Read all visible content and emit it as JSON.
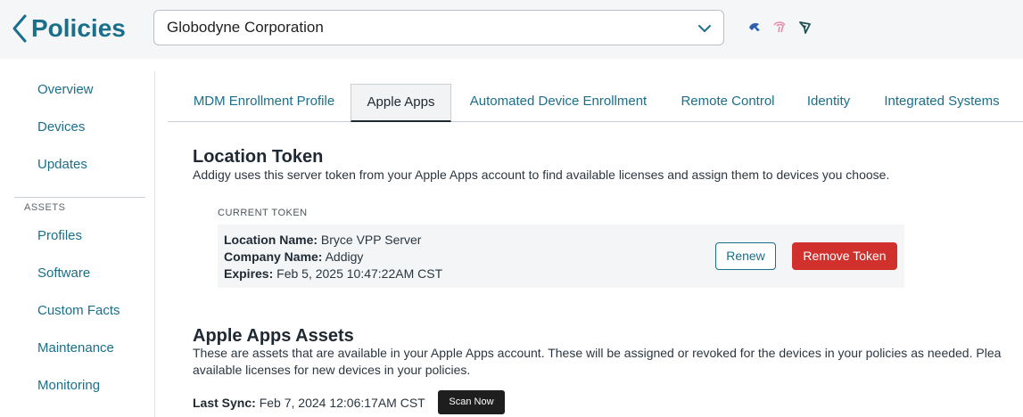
{
  "header": {
    "back_title": "Policies",
    "org_selected": "Globodyne Corporation",
    "icons": [
      "cursor-icon",
      "fingerprint-icon",
      "location-icon"
    ]
  },
  "sidebar": {
    "items_top": [
      "Overview",
      "Devices",
      "Updates"
    ],
    "section_label": "ASSETS",
    "items_assets": [
      "Profiles",
      "Software",
      "Custom Facts",
      "Maintenance",
      "Monitoring"
    ]
  },
  "tabs": [
    "MDM Enrollment Profile",
    "Apple Apps",
    "Automated Device Enrollment",
    "Remote Control",
    "Identity",
    "Integrated Systems"
  ],
  "active_tab": "Apple Apps",
  "location_token": {
    "title": "Location Token",
    "description": "Addigy uses this server token from your Apple Apps account to find available licenses and assign them to devices you choose.",
    "current_label": "CURRENT TOKEN",
    "location_name_label": "Location Name:",
    "location_name": "Bryce VPP Server",
    "company_name_label": "Company Name:",
    "company_name": "Addigy",
    "expires_label": "Expires:",
    "expires": "Feb 5, 2025 10:47:22AM CST",
    "renew_label": "Renew",
    "remove_label": "Remove Token"
  },
  "assets": {
    "title": "Apple Apps Assets",
    "description_line1": "These are assets that are available in your Apple Apps account. These will be assigned or revoked for the devices in your policies as needed. Plea",
    "description_line2": "available licenses for new devices in your policies.",
    "last_sync_label": "Last Sync:",
    "last_sync": "Feb 7, 2024 12:06:17AM CST",
    "scan_label": "Scan Now"
  },
  "colors": {
    "accent": "#1a6f8a",
    "danger": "#d0312d",
    "dark_button": "#1e1e1e"
  }
}
